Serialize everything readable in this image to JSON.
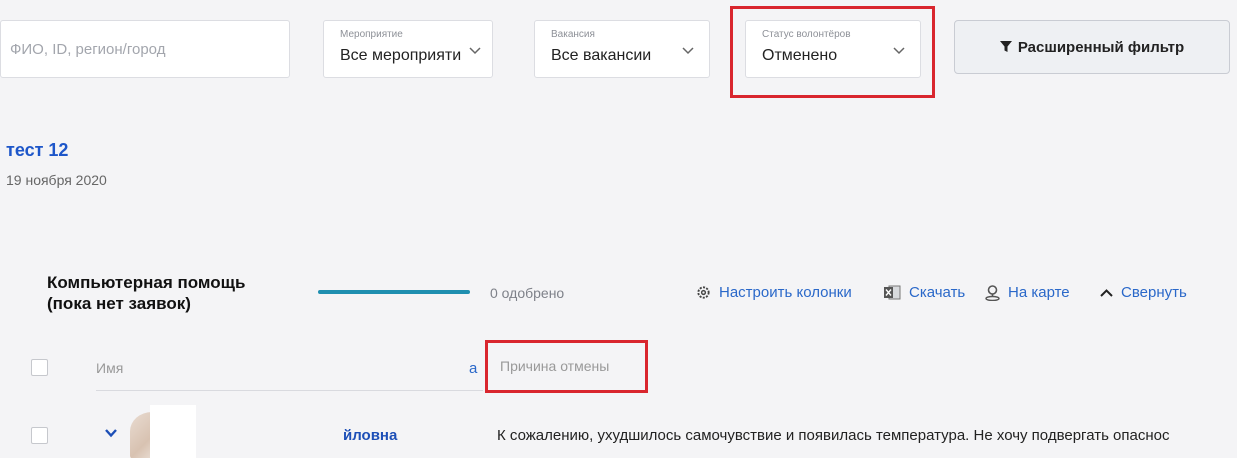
{
  "filters": {
    "search_placeholder": "ФИО, ID, регион/город",
    "event": {
      "caption": "Мероприятие",
      "value": "Все мероприяти"
    },
    "vacancy": {
      "caption": "Вакансия",
      "value": "Все вакансии"
    },
    "volunteer_status": {
      "caption": "Статус волонтёров",
      "value": "Отменено"
    },
    "advanced_filter_label": "Расширенный фильтр"
  },
  "event": {
    "title": "тест 12",
    "date": "19 ноября 2020"
  },
  "section": {
    "title_line1": "Компьютерная помощь",
    "title_line2": "(пока нет заявок)",
    "progress_fraction": 1.0,
    "approved_text": "0 одобрено",
    "actions": {
      "columns": "Настроить колонки",
      "download": "Скачать",
      "map": "На карте",
      "collapse": "Свернуть"
    }
  },
  "table": {
    "headers": {
      "name": "Имя",
      "partial": "а",
      "reason": "Причина отмены"
    },
    "rows": [
      {
        "surname_fragment": "йловна",
        "reason": "К сожалению, ухудшилось самочувствие и появилась температура. Не хочу подвергать опаснос"
      }
    ]
  },
  "colors": {
    "accent_blue": "#1d56c9",
    "highlight_red": "#d9262e",
    "progress_teal": "#1f8fb0"
  }
}
